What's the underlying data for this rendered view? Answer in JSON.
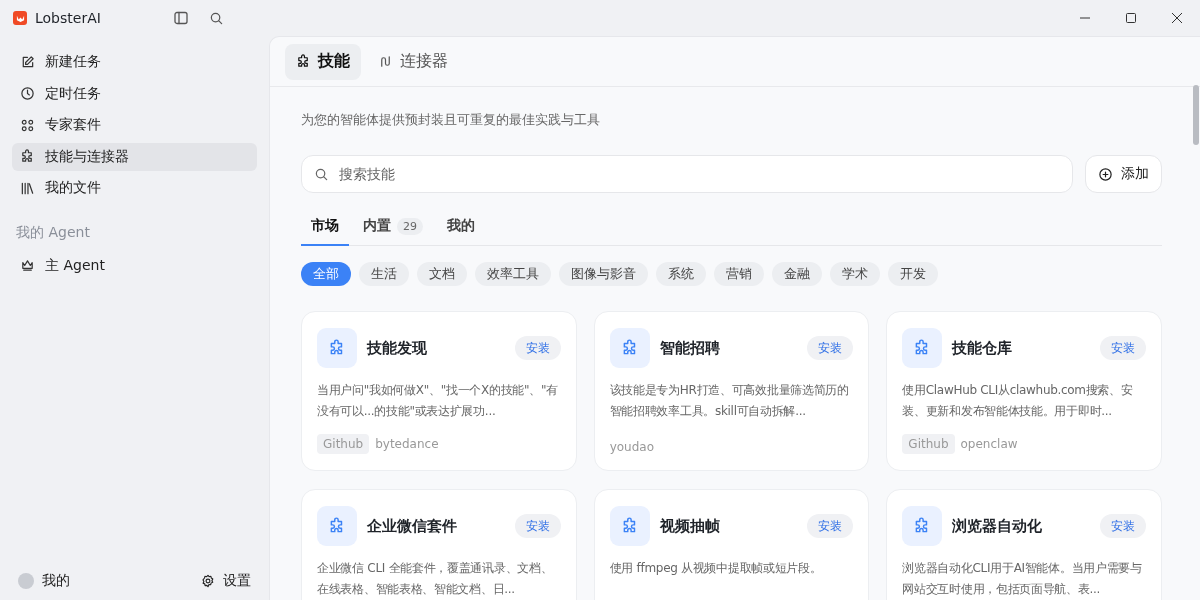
{
  "app": {
    "title": "LobsterAI"
  },
  "sidebar": {
    "items": [
      {
        "label": "新建任务",
        "selected": false
      },
      {
        "label": "定时任务",
        "selected": false
      },
      {
        "label": "专家套件",
        "selected": false
      },
      {
        "label": "技能与连接器",
        "selected": true
      },
      {
        "label": "我的文件",
        "selected": false
      }
    ],
    "section_title": "我的 Agent",
    "agents": [
      {
        "label": "主 Agent",
        "selected": false
      }
    ],
    "footer": {
      "profile": "我的",
      "settings": "设置"
    }
  },
  "header_tabs": [
    {
      "label": "技能",
      "selected": true
    },
    {
      "label": "连接器",
      "selected": false
    }
  ],
  "subtitle": "为您的智能体提供预封装且可重复的最佳实践与工具",
  "search": {
    "placeholder": "搜索技能"
  },
  "add_button": "添加",
  "tabs": [
    {
      "label": "市场",
      "selected": true
    },
    {
      "label": "内置",
      "count": "29",
      "selected": false
    },
    {
      "label": "我的",
      "selected": false
    }
  ],
  "categories": [
    {
      "label": "全部",
      "selected": true
    },
    {
      "label": "生活",
      "selected": false
    },
    {
      "label": "文档",
      "selected": false
    },
    {
      "label": "效率工具",
      "selected": false
    },
    {
      "label": "图像与影音",
      "selected": false
    },
    {
      "label": "系统",
      "selected": false
    },
    {
      "label": "营销",
      "selected": false
    },
    {
      "label": "金融",
      "selected": false
    },
    {
      "label": "学术",
      "selected": false
    },
    {
      "label": "开发",
      "selected": false
    }
  ],
  "skills": [
    {
      "name": "技能发现",
      "action": "安装",
      "description": "当用户问\"我如何做X\"、\"找一个X的技能\"、\"有没有可以...的技能\"或表达扩展功...",
      "source": "Github",
      "author": "bytedance"
    },
    {
      "name": "智能招聘",
      "action": "安装",
      "description": "该技能是专为HR打造、可高效批量筛选简历的智能招聘效率工具。skill可自动拆解...",
      "author": "youdao"
    },
    {
      "name": "技能仓库",
      "action": "安装",
      "description": "使用ClawHub CLI从clawhub.com搜索、安装、更新和发布智能体技能。用于即时...",
      "source": "Github",
      "author": "openclaw"
    },
    {
      "name": "企业微信套件",
      "action": "安装",
      "description": "企业微信 CLI 全能套件，覆盖通讯录、文档、在线表格、智能表格、智能文档、日..."
    },
    {
      "name": "视频抽帧",
      "action": "安装",
      "description": "使用 ffmpeg 从视频中提取帧或短片段。"
    },
    {
      "name": "浏览器自动化",
      "action": "安装",
      "description": "浏览器自动化CLI用于AI智能体。当用户需要与网站交互时使用，包括页面导航、表..."
    }
  ]
}
